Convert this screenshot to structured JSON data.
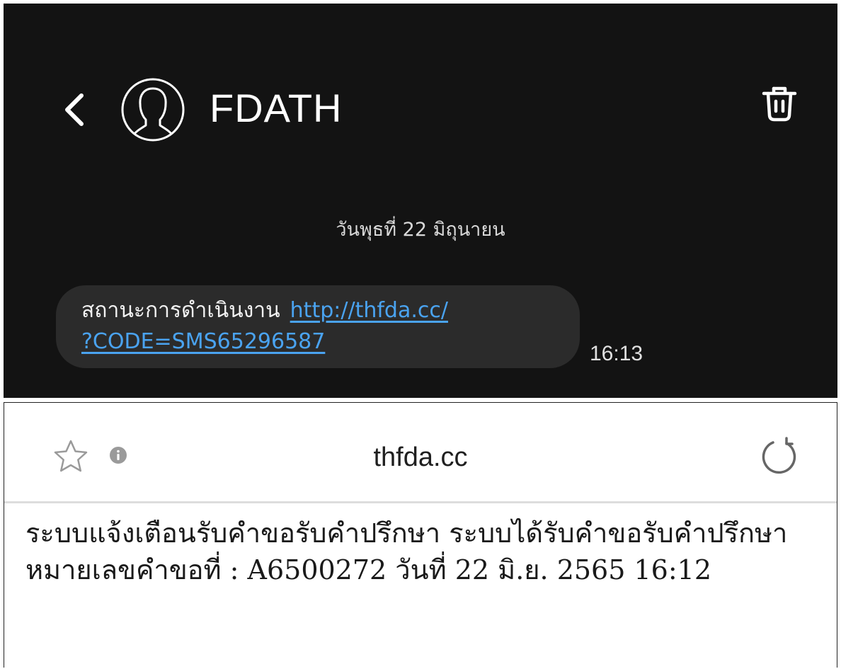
{
  "sms": {
    "contact_name": "FDATH",
    "date_separator": "วันพุธที่ 22 มิถุนายน",
    "message": {
      "label": "สถานะการดำเนินงาน",
      "link_line1": "http://thfda.cc/",
      "link_line2": "?CODE=SMS65296587",
      "time": "16:13"
    },
    "icons": {
      "back": "back-chevron-icon",
      "avatar": "contact-avatar-icon",
      "delete": "trash-icon"
    },
    "colors": {
      "background": "#131313",
      "bubble": "#2b2b2b",
      "link": "#4aa3f0"
    }
  },
  "browser": {
    "domain": "thfda.cc",
    "body_text": "ระบบแจ้งเตือนรับคำขอรับคำปรึกษา ระบบได้รับคำขอรับคำปรึกษาหมายเลขคำขอที่ : A6500272 วันที่ 22 มิ.ย. 2565 16:12",
    "icons": {
      "bookmark": "star-icon",
      "site_info": "info-icon",
      "reload": "reload-icon"
    }
  }
}
